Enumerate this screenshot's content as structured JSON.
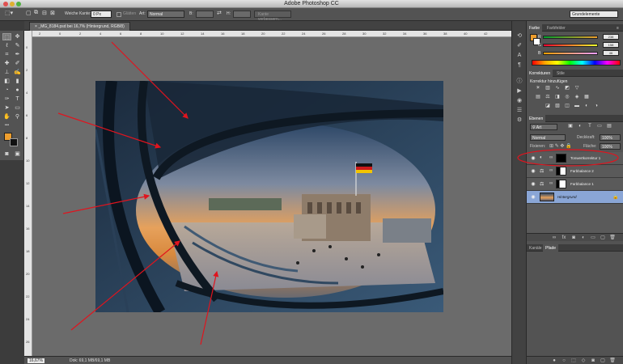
{
  "window": {
    "title": "Adobe Photoshop CC"
  },
  "options_bar": {
    "feather_label": "Weiche Kante:",
    "feather_value": "0 Px",
    "smooth_label": "Glätten",
    "style_label": "Art:",
    "style_value": "Normal",
    "width_label": "B:",
    "height_label": "H:",
    "refine_edge_button": "Kante verbessern...",
    "workspace_value": "Grundelemente"
  },
  "document": {
    "tab_label": "_MG_8184.psd bei 16,7% (Hintergrund, RGB/8)",
    "tab_close": "×",
    "zoom": "16,67%",
    "doc_info": "Dok: 69,1 MB/69,1 MB"
  },
  "rulers": {
    "top_labels": [
      "2",
      "0",
      "2",
      "4",
      "6",
      "8",
      "10",
      "12",
      "14",
      "16",
      "18",
      "20",
      "22",
      "24",
      "26",
      "28",
      "30",
      "32",
      "34",
      "36",
      "38",
      "40",
      "42"
    ],
    "left_labels": [
      "0",
      "2",
      "4",
      "6",
      "8",
      "10",
      "12",
      "14",
      "16",
      "18",
      "20",
      "22",
      "24",
      "26"
    ]
  },
  "color_panel": {
    "tabs": [
      "Farbe",
      "Farbfelder"
    ],
    "channels": [
      {
        "label": "R",
        "value": "238",
        "fraction": 0.93
      },
      {
        "label": "G",
        "value": "158",
        "fraction": 0.62
      },
      {
        "label": "B",
        "value": "46",
        "fraction": 0.18
      }
    ],
    "foreground_color": "#ee9e2e"
  },
  "adjustments_panel": {
    "tabs": [
      "Korrekturen",
      "Stile"
    ],
    "heading": "Korrektur hinzufügen"
  },
  "layers_panel": {
    "tabs": [
      "Ebenen"
    ],
    "filter_kind": "Art",
    "blend_mode": "Normal",
    "opacity_label": "Deckkraft:",
    "opacity_value": "100%",
    "lock_label": "Fixieren:",
    "fill_label": "Fläche:",
    "fill_value": "100%",
    "layers": [
      {
        "name": "Tonwertkorrektur 1",
        "selected": false
      },
      {
        "name": "Farbbalance 2",
        "selected": false
      },
      {
        "name": "Farbbalance 1",
        "selected": false
      },
      {
        "name": "Hintergrund",
        "selected": true
      }
    ]
  },
  "paths_panel": {
    "tabs": [
      "Kanäle",
      "Pfade"
    ]
  },
  "icons": {
    "eye": "eye-icon",
    "lock": "lock-icon",
    "chain": "link-icon"
  },
  "colors": {
    "annotation": "#e0141e",
    "selection": "#8aa6d6"
  }
}
